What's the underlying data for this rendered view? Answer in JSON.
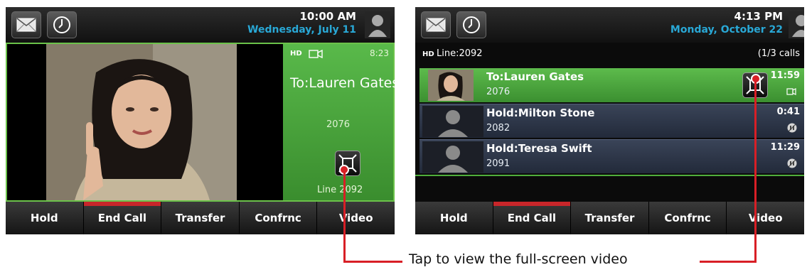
{
  "left_screen": {
    "time": "10:00 AM",
    "date": "Wednesday, July 11",
    "call": {
      "hd_label": "HD",
      "timer": "8:23",
      "to_label": "To:Lauren Gates",
      "number": "2076",
      "line": "Line 2092"
    },
    "softkeys": [
      "Hold",
      "End Call",
      "Transfer",
      "Confrnc",
      "Video"
    ]
  },
  "right_screen": {
    "time": "4:13 PM",
    "date": "Monday, October 22",
    "hd_label": "HD",
    "line_label": "Line:2092",
    "call_count": "(1/3 calls",
    "calls": [
      {
        "name": "To:Lauren Gates",
        "number": "2076",
        "time": "11:59",
        "status_icon": "video-icon"
      },
      {
        "name": "Hold:Milton Stone",
        "number": "2082",
        "time": "0:41",
        "status_icon": "hold-icon"
      },
      {
        "name": "Hold:Teresa Swift",
        "number": "2091",
        "time": "11:29",
        "status_icon": "hold-icon"
      }
    ],
    "softkeys": [
      "Hold",
      "End Call",
      "Transfer",
      "Confrnc",
      "Video"
    ]
  },
  "caption": "Tap to view the full-screen video",
  "colors": {
    "accent_green": "#4fae3c",
    "date_blue": "#29a8d6",
    "annotation_red": "#d81f26",
    "end_call_red": "#c8262a"
  }
}
